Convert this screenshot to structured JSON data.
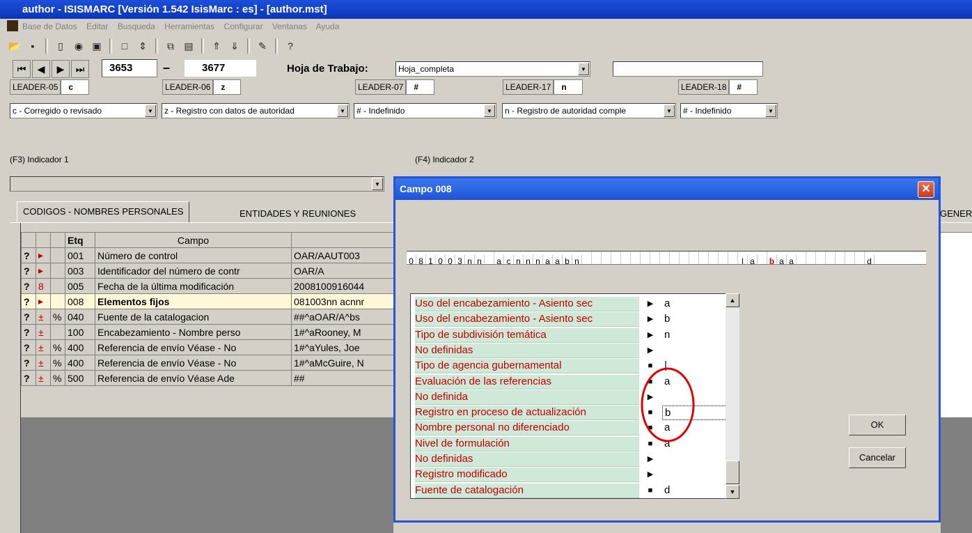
{
  "window": {
    "title": "author - ISISMARC [Versión 1.542 IsisMarc : es] - [author.mst]"
  },
  "menu": [
    "Base de Datos",
    "Editar",
    "Busqueda",
    "Herramientas",
    "Configurar",
    "Ventanas",
    "Ayuda"
  ],
  "toolbar": {
    "icons": [
      "open-folder-icon",
      "save-icon",
      "new-icon",
      "globe-icon",
      "book-icon",
      "frame-icon",
      "swap-icon",
      "copy-icon",
      "paste-icon",
      "up-icon",
      "down-icon",
      "edit-icon",
      "help-icon"
    ]
  },
  "nav": {
    "record_from": "3653",
    "dash": "–",
    "record_to": "3677",
    "worksheet_label": "Hoja de Trabajo:",
    "worksheet_value": "Hoja_completa"
  },
  "leaders": [
    {
      "label": "LEADER-05",
      "value": "c",
      "combo": "c - Corregido o revisado"
    },
    {
      "label": "LEADER-06",
      "value": "z",
      "combo": "z - Registro con datos de autoridad"
    },
    {
      "label": "LEADER-07",
      "value": "#",
      "combo": "# - Indefinido"
    },
    {
      "label": "LEADER-17",
      "value": "n",
      "combo": "n - Registro de autoridad comple"
    },
    {
      "label": "LEADER-18",
      "value": "#",
      "combo": "# - Indefinido"
    }
  ],
  "indicators": {
    "ind1": "(F3) Indicador 1",
    "ind2": "(F4) Indicador 2"
  },
  "tabs": [
    "CODIGOS - NOMBRES PERSONALES",
    "ENTIDADES Y REUNIONES",
    "GENER"
  ],
  "grid": {
    "headers": {
      "etq": "Etq",
      "campo": "Campo"
    },
    "rows": [
      {
        "q": "?",
        "mark": "▸",
        "pct": "",
        "tag": "001",
        "campo": "Número de control",
        "valor": "OAR/AAUT003",
        "bold": false
      },
      {
        "q": "?",
        "mark": "▸",
        "pct": "",
        "tag": "003",
        "campo": "Identificador del número de contr",
        "valor": "OAR/A",
        "bold": false
      },
      {
        "q": "?",
        "mark": "8",
        "pct": "",
        "tag": "005",
        "campo": "Fecha de la última modificación",
        "valor": "2008100916044",
        "bold": false
      },
      {
        "q": "?",
        "mark": "▸",
        "pct": "",
        "tag": "008",
        "campo": "Elementos fijos",
        "valor": "081003nn acnnr",
        "bold": true
      },
      {
        "q": "?",
        "mark": "±",
        "pct": "%",
        "tag": "040",
        "campo": "Fuente de la catalogacion",
        "valor": "##^aOAR/A^bs",
        "bold": false
      },
      {
        "q": "?",
        "mark": "±",
        "pct": "",
        "tag": "100",
        "campo": "Encabezamiento - Nombre perso",
        "valor": "1#^aRooney, M",
        "bold": false
      },
      {
        "q": "?",
        "mark": "±",
        "pct": "%",
        "tag": "400",
        "campo": "Referencia de envío Véase - No",
        "valor": "1#^aYules, Joe",
        "bold": false
      },
      {
        "q": "?",
        "mark": "±",
        "pct": "%",
        "tag": "400",
        "campo": "Referencia de envío Véase - No",
        "valor": "1#^aMcGuire, N",
        "bold": false
      },
      {
        "q": "?",
        "mark": "±",
        "pct": "%",
        "tag": "500",
        "campo": "Referencia de envío Véase Ade",
        "valor": "##",
        "bold": false
      }
    ]
  },
  "dialog": {
    "title": "Campo 008",
    "code_chars": [
      "0",
      "8",
      "1",
      "0",
      "0",
      "3",
      "n",
      "n",
      "",
      "a",
      "c",
      "n",
      "n",
      "n",
      "a",
      "a",
      "b",
      "n",
      "",
      "",
      "",
      "",
      "",
      "",
      "",
      "",
      "",
      "",
      "",
      "",
      "",
      "",
      "",
      "",
      "|",
      "a",
      "",
      "b",
      "a",
      "a",
      "",
      "",
      "",
      "",
      "",
      "",
      "",
      "d"
    ],
    "fields": [
      {
        "name": "Uso del encabezamiento - Asiento sec",
        "icon": "▶",
        "value": "a"
      },
      {
        "name": "Uso del encabezamiento - Asiento sec",
        "icon": "▶",
        "value": "b"
      },
      {
        "name": "Tipo de subdivisión temática",
        "icon": "▶",
        "value": "n"
      },
      {
        "name": "No definidas",
        "icon": "▶",
        "value": ""
      },
      {
        "name": "Tipo de agencia gubernamental",
        "icon": "■",
        "value": "|"
      },
      {
        "name": "Evaluación de las referencias",
        "icon": "■",
        "value": "a"
      },
      {
        "name": "No definida",
        "icon": "▶",
        "value": ""
      },
      {
        "name": "Registro en proceso de actualización",
        "icon": "■",
        "value": "b"
      },
      {
        "name": "Nombre personal no diferenciado",
        "icon": "■",
        "value": "a"
      },
      {
        "name": "Nivel de formulación",
        "icon": "■",
        "value": "a"
      },
      {
        "name": "No definidas",
        "icon": "▶",
        "value": ""
      },
      {
        "name": "Registro modificado",
        "icon": "▶",
        "value": ""
      },
      {
        "name": "Fuente de catalogación",
        "icon": "■",
        "value": "d"
      }
    ],
    "ok_label": "OK",
    "cancel_label": "Cancelar",
    "highlight_color": "#e00000"
  }
}
